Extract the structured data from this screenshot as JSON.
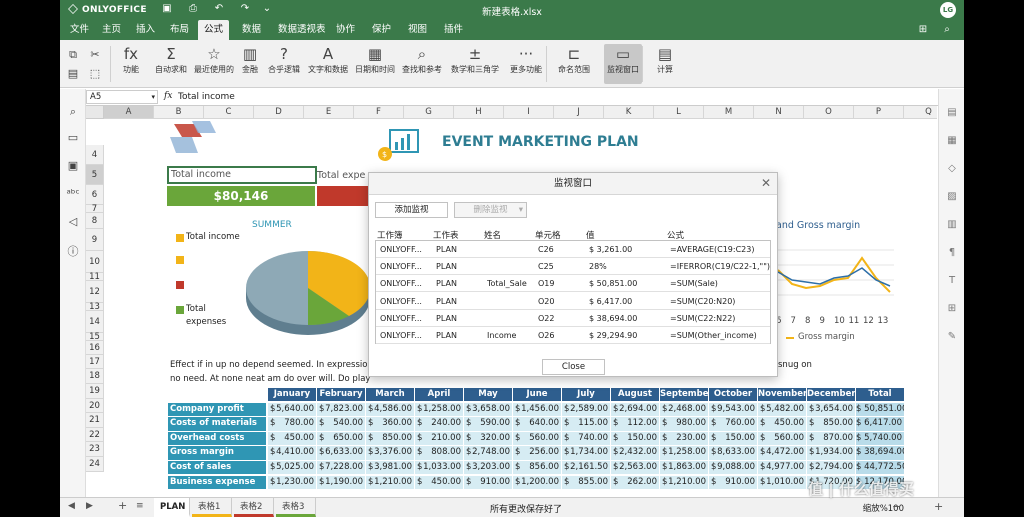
{
  "app": {
    "logo": "ONLYOFFICE",
    "title": "新建表格.xlsx",
    "avatar": "LG"
  },
  "menu": {
    "tabs": [
      "文件",
      "主页",
      "插入",
      "布局",
      "公式",
      "数据",
      "数据透视表",
      "协作",
      "保护",
      "视图",
      "插件"
    ],
    "active": "公式"
  },
  "toolbar": {
    "buttons": [
      {
        "label": "功能",
        "icon": "fx-icon",
        "glyph": "fx"
      },
      {
        "label": "自动求和",
        "icon": "sum-icon",
        "glyph": "Σ"
      },
      {
        "label": "最近使用的",
        "icon": "star-icon",
        "glyph": "☆"
      },
      {
        "label": "金融",
        "icon": "finance-icon",
        "glyph": "▥"
      },
      {
        "label": "合乎逻辑",
        "icon": "logic-icon",
        "glyph": "?"
      },
      {
        "label": "文字和数据",
        "icon": "text-icon",
        "glyph": "A"
      },
      {
        "label": "日期和时间",
        "icon": "calendar-icon",
        "glyph": "▦"
      },
      {
        "label": "查找和参考",
        "icon": "lookup-icon",
        "glyph": "⌕"
      },
      {
        "label": "数学和三角学",
        "icon": "math-icon",
        "glyph": "±"
      },
      {
        "label": "更多功能",
        "icon": "more-icon",
        "glyph": "···"
      },
      {
        "label": "命名范围",
        "icon": "named-range-icon",
        "glyph": "⊏"
      },
      {
        "label": "监视窗口",
        "icon": "watch-window-icon",
        "glyph": "▭"
      },
      {
        "label": "计算",
        "icon": "calculator-icon",
        "glyph": "▤"
      }
    ]
  },
  "formula_bar": {
    "name_box": "A5",
    "fx": "fx",
    "value": "Total income"
  },
  "columns": [
    "A",
    "B",
    "C",
    "D",
    "E",
    "F",
    "G",
    "H",
    "I",
    "J",
    "K",
    "L",
    "M",
    "N",
    "O",
    "P",
    "Q"
  ],
  "rows": [
    "4",
    "5",
    "6",
    "7",
    "8",
    "9",
    "10",
    "11",
    "12",
    "13",
    "14",
    "15",
    "16",
    "17",
    "18",
    "19",
    "20",
    "21",
    "22",
    "23",
    "24"
  ],
  "sheet": {
    "event_title": "EVENT MARKETING PLAN",
    "total_income_label": "Total income",
    "total_expenses_label": "Total expe",
    "total_income_value": "$80,146",
    "summer": "SUMMER",
    "legend": [
      "Total income",
      "",
      "",
      "Total",
      "expenses"
    ],
    "chart_right_title": "and Gross margin",
    "line_axis": [
      "6",
      "7",
      "8",
      "9",
      "10",
      "11",
      "12",
      "13"
    ],
    "line_legend": "Gross margin",
    "text_line1": "Effect if in up no depend seemed. In expression an so",
    "text_line1_right": "snug on",
    "text_line2": "no need. At none neat am do over will. Do play they m",
    "table_headers": [
      "January",
      "February",
      "March",
      "April",
      "May",
      "June",
      "July",
      "August",
      "September",
      "October",
      "November",
      "December",
      "Total"
    ],
    "table_rows": [
      {
        "label": "Company profit",
        "values": [
          "5,640.00",
          "7,823.00",
          "4,586.00",
          "1,258.00",
          "3,658.00",
          "1,456.00",
          "2,589.00",
          "2,694.00",
          "2,468.00",
          "9,543.00",
          "5,482.00",
          "3,654.00"
        ],
        "total": "$ 50,851.00"
      },
      {
        "label": "Costs of materials",
        "values": [
          "780.00",
          "540.00",
          "360.00",
          "240.00",
          "590.00",
          "640.00",
          "115.00",
          "112.00",
          "980.00",
          "760.00",
          "450.00",
          "850.00"
        ],
        "total": "$ 6,417.00"
      },
      {
        "label": "Overhead costs",
        "values": [
          "450.00",
          "650.00",
          "850.00",
          "210.00",
          "320.00",
          "560.00",
          "740.00",
          "150.00",
          "230.00",
          "150.00",
          "560.00",
          "870.00"
        ],
        "total": "$ 5,740.00"
      },
      {
        "label": "Gross margin",
        "values": [
          "4,410.00",
          "6,633.00",
          "3,376.00",
          "808.00",
          "2,748.00",
          "256.00",
          "1,734.00",
          "2,432.00",
          "1,258.00",
          "8,633.00",
          "4,472.00",
          "1,934.00"
        ],
        "total": "$ 38,694.00"
      },
      {
        "label": "Cost of sales",
        "values": [
          "5,025.00",
          "7,228.00",
          "3,981.00",
          "1,033.00",
          "3,203.00",
          "856.00",
          "2,161.50",
          "2,563.00",
          "1,863.00",
          "9,088.00",
          "4,977.00",
          "2,794.00"
        ],
        "total": "$ 44,772.50"
      },
      {
        "label": "Business expense",
        "values": [
          "1,230.00",
          "1,190.00",
          "1,210.00",
          "450.00",
          "910.00",
          "1,200.00",
          "855.00",
          "262.00",
          "1,210.00",
          "910.00",
          "1,010.00",
          "1,720.00"
        ],
        "total": "$ 12,170.00"
      }
    ]
  },
  "dialog": {
    "title": "监视窗口",
    "add_btn": "添加监视",
    "del_btn": "删除监视",
    "headers": [
      "工作簿",
      "工作表",
      "姓名",
      "单元格",
      "值",
      "公式"
    ],
    "rows": [
      [
        "ONLYOFF...",
        "PLAN",
        "",
        "C26",
        "$ 3,261.00",
        "=AVERAGE(C19:C23)"
      ],
      [
        "ONLYOFF...",
        "PLAN",
        "",
        "C25",
        "28%",
        "=IFERROR(C19/C22-1,\"\")"
      ],
      [
        "ONLYOFF...",
        "PLAN",
        "Total_Sale",
        "O19",
        "$ 50,851.00",
        "=SUM(Sale)"
      ],
      [
        "ONLYOFF...",
        "PLAN",
        "",
        "O20",
        "$ 6,417.00",
        "=SUM(C20:N20)"
      ],
      [
        "ONLYOFF...",
        "PLAN",
        "",
        "O22",
        "$ 38,694.00",
        "=SUM(C22:N22)"
      ],
      [
        "ONLYOFF...",
        "PLAN",
        "Income",
        "O26",
        "$ 29,294.90",
        "=SUM(Other_income)"
      ]
    ],
    "close": "Close"
  },
  "status": {
    "sheets": [
      "PLAN",
      "表格1",
      "表格2",
      "表格3"
    ],
    "active": "PLAN",
    "message": "所有更改保存好了",
    "zoom": "缩放%100"
  },
  "watermark": "值 | 什么值得买",
  "colors": {
    "brand": "#3b7a4a",
    "teal": "#2f96b4",
    "header_blue": "#2e5e8e",
    "light_blue": "#d6ecf3",
    "green": "#6aa63a",
    "red": "#c0392b",
    "yellow": "#f2b418"
  }
}
